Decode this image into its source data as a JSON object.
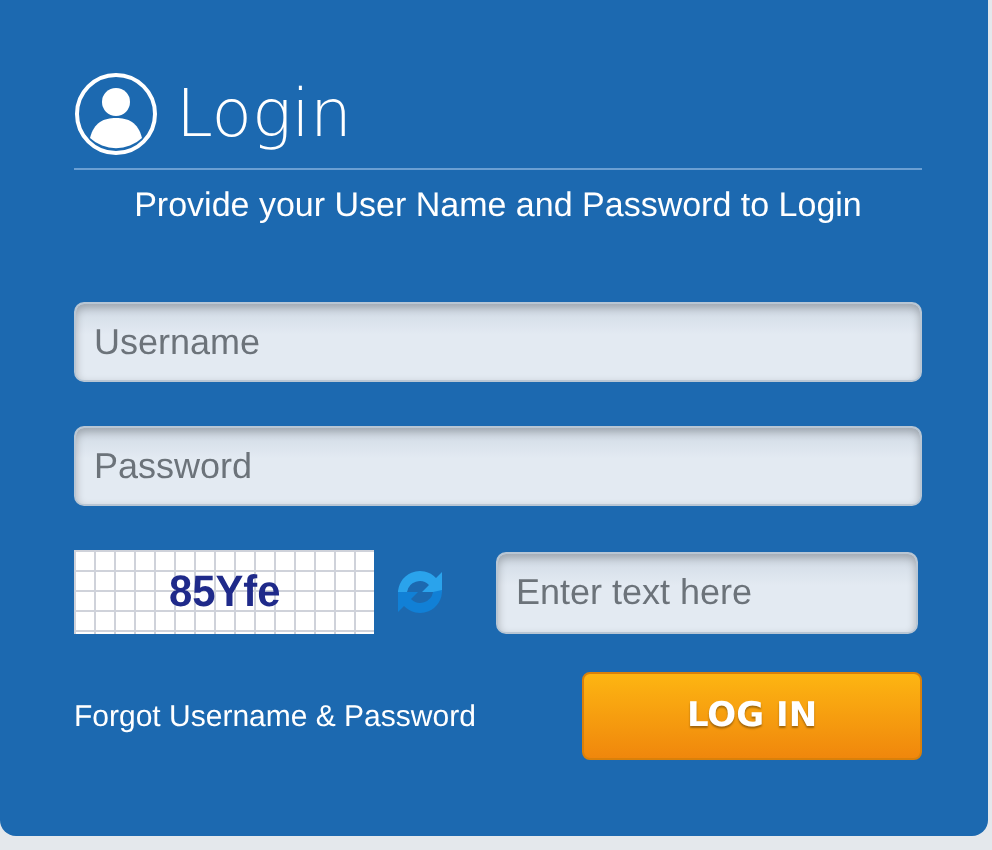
{
  "header": {
    "title": "Login",
    "subtitle": "Provide your User Name and Password to Login"
  },
  "fields": [
    {
      "placeholder": "Username"
    },
    {
      "placeholder": "Password"
    }
  ],
  "captcha": {
    "code": "85Yfe",
    "placeholder": "Enter text here"
  },
  "forgot_link": "Forgot Username & Password",
  "login_button": "LOG IN"
}
